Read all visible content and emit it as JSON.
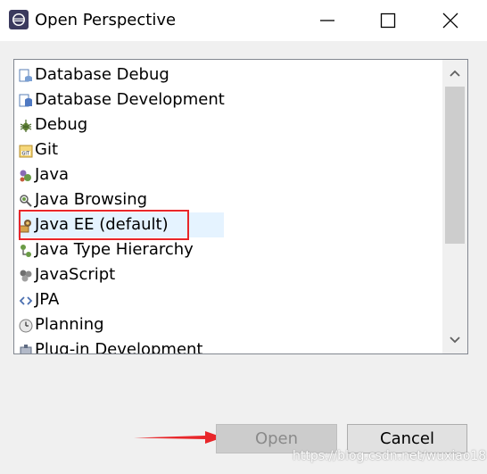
{
  "window": {
    "title": "Open Perspective",
    "icon": "eclipse-icon",
    "controls": [
      "minimize-icon",
      "maximize-icon",
      "close-icon"
    ]
  },
  "perspectives": {
    "items": [
      {
        "label": "Database Debug",
        "icon": "database-debug-icon"
      },
      {
        "label": "Database Development",
        "icon": "database-development-icon"
      },
      {
        "label": "Debug",
        "icon": "debug-icon"
      },
      {
        "label": "Git",
        "icon": "git-icon"
      },
      {
        "label": "Java",
        "icon": "java-icon"
      },
      {
        "label": "Java Browsing",
        "icon": "java-browsing-icon"
      },
      {
        "label": "Java EE (default)",
        "icon": "java-ee-icon",
        "selected": true
      },
      {
        "label": "Java Type Hierarchy",
        "icon": "java-type-hierarchy-icon"
      },
      {
        "label": "JavaScript",
        "icon": "javascript-icon"
      },
      {
        "label": "JPA",
        "icon": "jpa-icon"
      },
      {
        "label": "Planning",
        "icon": "planning-icon"
      },
      {
        "label": "Plug-in Development",
        "icon": "plugin-development-icon"
      }
    ]
  },
  "buttons": {
    "open_label": "Open",
    "open_enabled": false,
    "cancel_label": "Cancel"
  },
  "annotation": {
    "highlight_color": "#e8262a",
    "arrow_color": "#e8262a"
  },
  "watermark": "https://blog.csdn.net/wuxiao18"
}
